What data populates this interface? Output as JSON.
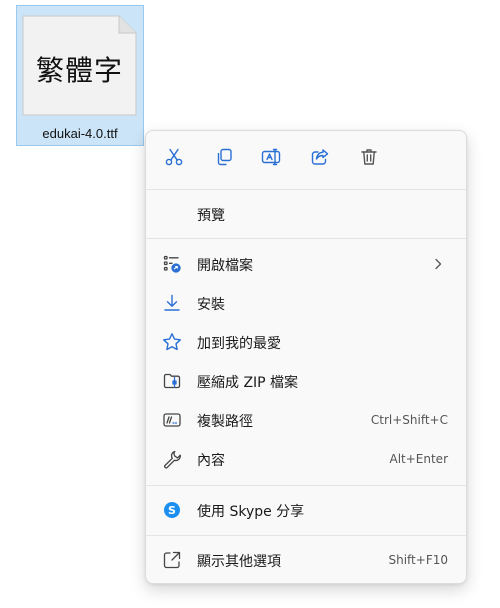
{
  "file": {
    "name": "edukai-4.0.ttf",
    "preview_text": "繁體字",
    "icon": "font-file-icon"
  },
  "menu": {
    "toolbar": [
      {
        "icon": "cut-icon"
      },
      {
        "icon": "copy-icon"
      },
      {
        "icon": "rename-icon"
      },
      {
        "icon": "share-icon"
      },
      {
        "icon": "delete-icon"
      }
    ],
    "items": [
      {
        "label": "預覽",
        "icon": ""
      },
      {
        "label": "開啟檔案",
        "icon": "open-with-icon",
        "submenu": true
      },
      {
        "label": "安裝",
        "icon": "download-icon"
      },
      {
        "label": "加到我的最愛",
        "icon": "star-icon"
      },
      {
        "label": "壓縮成 ZIP 檔案",
        "icon": "zip-icon"
      },
      {
        "label": "複製路徑",
        "icon": "copy-path-icon",
        "shortcut": "Ctrl+Shift+C"
      },
      {
        "label": "內容",
        "icon": "wrench-icon",
        "shortcut": "Alt+Enter"
      },
      {
        "label": "使用 Skype 分享",
        "icon": "skype-icon"
      },
      {
        "label": "顯示其他選項",
        "icon": "more-options-icon",
        "shortcut": "Shift+F10"
      }
    ]
  },
  "colors": {
    "accent": "#2a6fd6",
    "selection": "#cce4f7",
    "skype": "#1a8ff0"
  }
}
